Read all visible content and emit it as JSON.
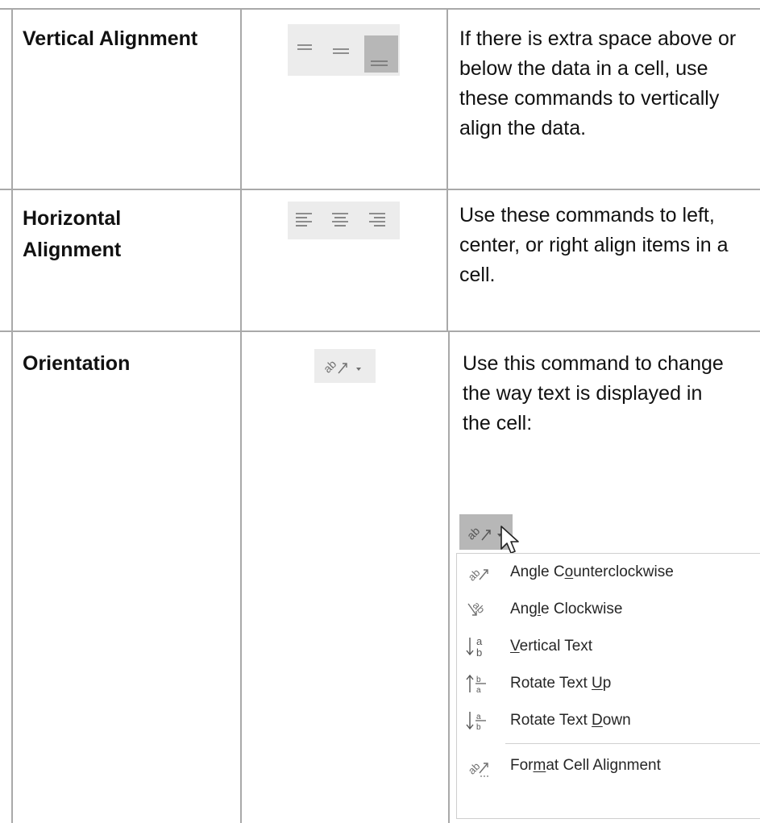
{
  "rows": [
    {
      "label": "Vertical Alignment",
      "description": "If there is extra space above or below the data in a cell, use these commands to vertically align the data.",
      "icons": [
        "align-top-icon",
        "align-middle-icon",
        "align-bottom-icon"
      ],
      "selected_icon": "align-bottom-icon"
    },
    {
      "label_line1": "Horizontal",
      "label_line2": "Alignment",
      "description": "Use these commands to left, center, or right align items in a cell.",
      "icons": [
        "align-left-icon",
        "align-center-icon",
        "align-right-icon"
      ]
    },
    {
      "label": "Orientation",
      "description": "Use this command to change the way text is displayed in the cell:",
      "icons": [
        "orientation-icon",
        "dropdown-arrow-icon"
      ]
    }
  ],
  "orientation_menu": {
    "items": [
      {
        "pre": "Angle C",
        "u": "o",
        "post": "unterclockwise",
        "icon": "angle-counterclockwise-icon"
      },
      {
        "pre": "Ang",
        "u": "l",
        "post": "e Clockwise",
        "icon": "angle-clockwise-icon"
      },
      {
        "pre": "",
        "u": "V",
        "post": "ertical Text",
        "icon": "vertical-text-icon"
      },
      {
        "pre": "Rotate Text ",
        "u": "U",
        "post": "p",
        "icon": "rotate-text-up-icon"
      },
      {
        "pre": "Rotate Text ",
        "u": "D",
        "post": "own",
        "icon": "rotate-text-down-icon"
      },
      {
        "pre": "For",
        "u": "m",
        "post": "at Cell Alignment",
        "icon": "format-cell-alignment-icon"
      }
    ]
  },
  "colors": {
    "grid": "#a9a9a9",
    "icon_strip": "#ececec",
    "icon_selected": "#b7b7b7",
    "icon_glyph": "#6f6f6f"
  }
}
